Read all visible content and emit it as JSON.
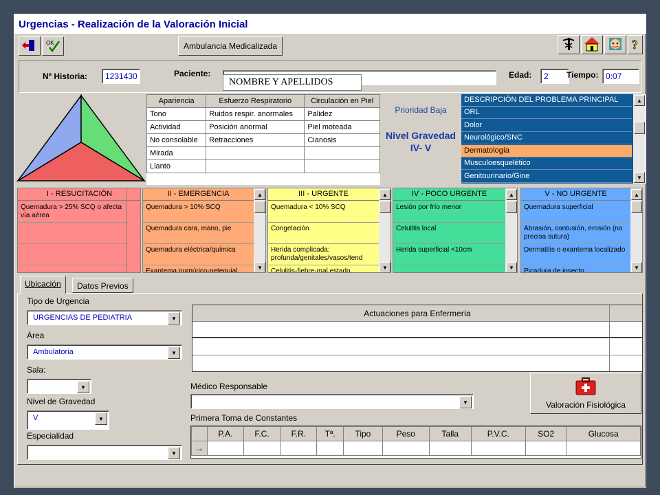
{
  "window": {
    "title": "Urgencias - Realización de la Valoración Inicial"
  },
  "toolbar": {
    "ambulance_label": "Ambulancia Medicalizada"
  },
  "header": {
    "historia_label": "Nº Historia:",
    "historia_value": "1231430",
    "paciente_label": "Paciente:",
    "paciente_value": "NOMBRE Y APELLIDOS",
    "edad_label": "Edad:",
    "edad_value": "2",
    "tiempo_label": "Tiempo:",
    "tiempo_value": "0:07"
  },
  "triangle_colors": {
    "left": "#8fa8ee",
    "right": "#66dd77",
    "bottom": "#ee5f5f"
  },
  "assessment": {
    "headers": [
      "Apariencia",
      "Esfuerzo Respiratorio",
      "Circulación en Piel"
    ],
    "rows": [
      [
        "Tono",
        "Ruidos respir. anormales",
        "Palidez"
      ],
      [
        "Actividad",
        "Posición anormal",
        "Piel moteada"
      ],
      [
        "No consolable",
        "Retracciones",
        "Cianosis"
      ],
      [
        "Mirada",
        "",
        ""
      ],
      [
        "Llanto",
        "",
        ""
      ]
    ]
  },
  "priority": {
    "label": "Prioridad Baja",
    "level_line1": "Nivel Gravedad",
    "level_line2": "IV- V"
  },
  "problems": {
    "header": "DESCRIPCIÓN DEL PROBLEMA PRINCIPAL",
    "items": [
      "ORL",
      "Dolor",
      "Neurológico/SNC",
      "Dermatología",
      "Musculoesquelético",
      "Genitourinario/Gine"
    ],
    "selected_index": 3
  },
  "categories": [
    {
      "title": "I - RESUCITACIÓN",
      "color": "#ff8a8a",
      "items": [
        "Quemadura > 25% SCQ o afecta vía aérea",
        "",
        ""
      ]
    },
    {
      "title": "II - EMERGENCIA",
      "color": "#ffaa77",
      "items": [
        "Quemadura > 10% SCQ",
        "Quemadura cara, mano, pie",
        "Quemadura eléctrica/química",
        "Exantema purpúrico-petequial"
      ]
    },
    {
      "title": "III - URGENTE",
      "color": "#ffff88",
      "items": [
        "Quemadura < 10% SCQ",
        "Congelación",
        "Herida complicada: profunda/genitales/vasos/tend",
        "Celulitis-fiebre-mal estado"
      ]
    },
    {
      "title": "IV - POCO URGENTE",
      "color": "#44dd99",
      "items": [
        "Lesión por frío menor",
        "Celulitis local",
        "Herida superficial <10cm",
        ""
      ]
    },
    {
      "title": "V - NO URGENTE",
      "color": "#66aaff",
      "items": [
        "Quemadura superficial",
        "Abrasión, contusión, erosión (no precisa sutura)",
        "Dermatitis o exantema localizado",
        "Picadura de insecto"
      ]
    }
  ],
  "tabs": [
    "Ubicación",
    "Datos Previos"
  ],
  "form": {
    "tipo_label": "Tipo de Urgencia",
    "tipo_value": "URGENCIAS DE PEDIATRIA",
    "area_label": "Área",
    "area_value": "Ambulatoria",
    "sala_label": "Sala:",
    "sala_value": "",
    "nivel_label": "Nivel de Gravedad",
    "nivel_value": "V",
    "especialidad_label": "Especialidad",
    "especialidad_value": ""
  },
  "actuaciones": {
    "header": "Actuaciones para Enfermería"
  },
  "medico": {
    "label": "Médico Responsable",
    "value": ""
  },
  "valoracion_button": "Valoración Fisiológica",
  "constantes": {
    "label": "Primera Toma de Constantes",
    "columns": [
      "P.A.",
      "F.C.",
      "F.R.",
      "Tª.",
      "Tipo",
      "Peso",
      "Talla",
      "P.V.C.",
      "SO2",
      "Glucosa"
    ],
    "row_marker": "→"
  }
}
